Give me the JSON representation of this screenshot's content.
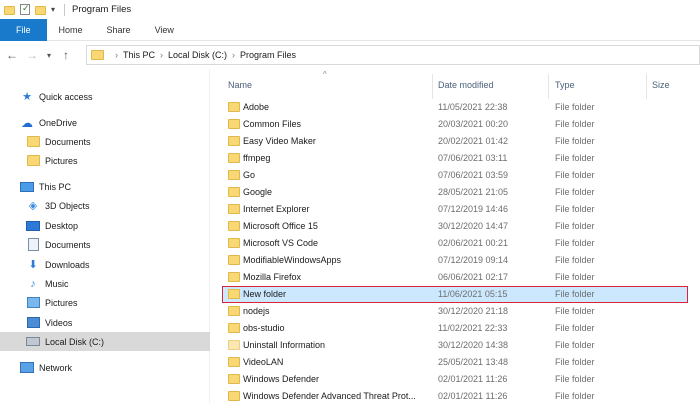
{
  "window": {
    "title": "Program Files",
    "title_sep": "|"
  },
  "ribbon": {
    "tabs": [
      "File",
      "Home",
      "Share",
      "View"
    ]
  },
  "address": {
    "crumbs": [
      "This PC",
      "Local Disk (C:)",
      "Program Files"
    ]
  },
  "sidebar": {
    "quick_access": "Quick access",
    "onedrive": "OneDrive",
    "onedrive_documents": "Documents",
    "onedrive_pictures": "Pictures",
    "this_pc": "This PC",
    "objects_3d": "3D Objects",
    "desktop": "Desktop",
    "documents": "Documents",
    "downloads": "Downloads",
    "music": "Music",
    "pictures": "Pictures",
    "videos": "Videos",
    "local_disk": "Local Disk (C:)",
    "network": "Network"
  },
  "columns": {
    "name": "Name",
    "date_modified": "Date modified",
    "type": "Type",
    "size": "Size",
    "sort_indicator": "^"
  },
  "files": [
    {
      "name": "Adobe",
      "date": "11/05/2021 22:38",
      "type": "File folder"
    },
    {
      "name": "Common Files",
      "date": "20/03/2021 00:20",
      "type": "File folder"
    },
    {
      "name": "Easy Video Maker",
      "date": "20/02/2021 01:42",
      "type": "File folder"
    },
    {
      "name": "ffmpeg",
      "date": "07/06/2021 03:11",
      "type": "File folder"
    },
    {
      "name": "Go",
      "date": "07/06/2021 03:59",
      "type": "File folder"
    },
    {
      "name": "Google",
      "date": "28/05/2021 21:05",
      "type": "File folder"
    },
    {
      "name": "Internet Explorer",
      "date": "07/12/2019 14:46",
      "type": "File folder"
    },
    {
      "name": "Microsoft Office 15",
      "date": "30/12/2020 14:47",
      "type": "File folder"
    },
    {
      "name": "Microsoft VS Code",
      "date": "02/06/2021 00:21",
      "type": "File folder"
    },
    {
      "name": "ModifiableWindowsApps",
      "date": "07/12/2019 09:14",
      "type": "File folder"
    },
    {
      "name": "Mozilla Firefox",
      "date": "06/06/2021 02:17",
      "type": "File folder"
    },
    {
      "name": "New folder",
      "date": "11/06/2021 05:15",
      "type": "File folder"
    },
    {
      "name": "nodejs",
      "date": "30/12/2020 21:18",
      "type": "File folder"
    },
    {
      "name": "obs-studio",
      "date": "11/02/2021 22:33",
      "type": "File folder"
    },
    {
      "name": "Uninstall Information",
      "date": "30/12/2020 14:38",
      "type": "File folder"
    },
    {
      "name": "VideoLAN",
      "date": "25/05/2021 13:48",
      "type": "File folder"
    },
    {
      "name": "Windows Defender",
      "date": "02/01/2021 11:26",
      "type": "File folder"
    },
    {
      "name": "Windows Defender Advanced Threat Prot...",
      "date": "02/01/2021 11:26",
      "type": "File folder"
    }
  ]
}
